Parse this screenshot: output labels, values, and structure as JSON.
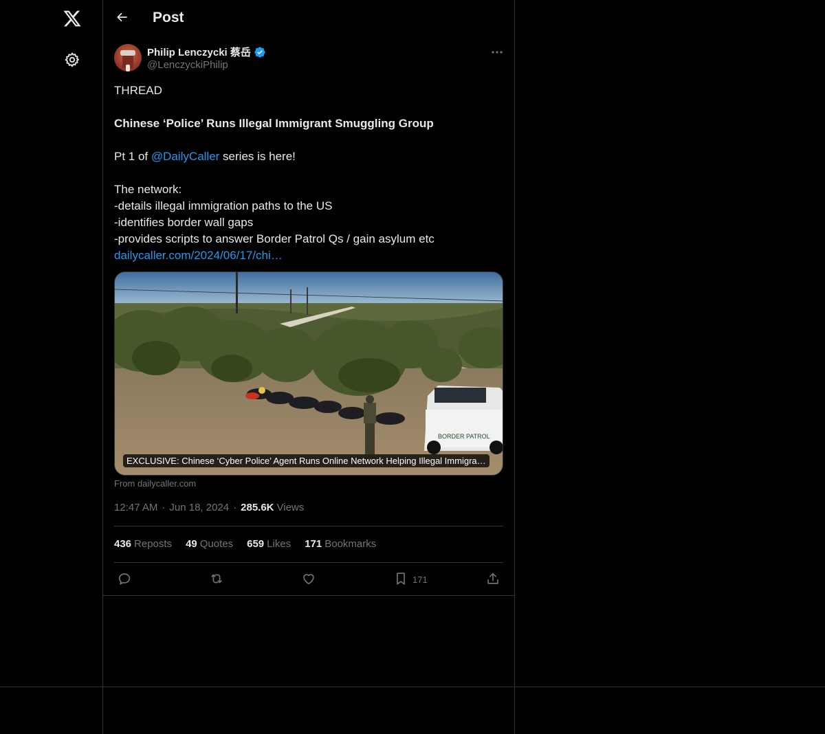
{
  "header": {
    "title": "Post"
  },
  "icons": {
    "logo": "x-logo-icon",
    "settings": "gear-icon",
    "back": "arrow-left-icon",
    "more": "more-horizontal-icon",
    "verified": "verified-badge-icon",
    "reply": "reply-icon",
    "repost": "repost-icon",
    "like": "heart-icon",
    "bookmark": "bookmark-icon",
    "share": "share-icon"
  },
  "author": {
    "name": "Philip Lenczycki 蔡岳",
    "handle": "@LenczyckiPhilip"
  },
  "tweet": {
    "line1": "THREAD",
    "line2": "Chinese ‘Police’ Runs Illegal Immigrant Smuggling Group",
    "line3_prefix": "Pt 1 of ",
    "line3_mention": "@DailyCaller",
    "line3_suffix": " series is here!",
    "line4": "The network:",
    "line5": "-details illegal immigration paths to the US",
    "line6": "-identifies border wall gaps",
    "line7": "-provides scripts to answer Border Patrol Qs / gain asylum etc",
    "link": "dailycaller.com/2024/06/17/chi…"
  },
  "card": {
    "caption": "EXCLUSIVE: Chinese ‘Cyber Police’ Agent Runs Online Network Helping Illegal Immigra…",
    "source": "From dailycaller.com",
    "vehicle_text": "BORDER PATROL"
  },
  "meta": {
    "time": "12:47 AM",
    "date": "Jun 18, 2024",
    "views_count": "285.6K",
    "views_label": "Views",
    "separator": "·"
  },
  "stats": {
    "reposts_count": "436",
    "reposts_label": "Reposts",
    "quotes_count": "49",
    "quotes_label": "Quotes",
    "likes_count": "659",
    "likes_label": "Likes",
    "bookmarks_count": "171",
    "bookmarks_label": "Bookmarks"
  },
  "actions": {
    "bookmark_count": "171"
  },
  "colors": {
    "background": "#000000",
    "text": "#e7e9ea",
    "muted": "#71767b",
    "border": "#2f3336",
    "accent": "#1d9bf0"
  }
}
